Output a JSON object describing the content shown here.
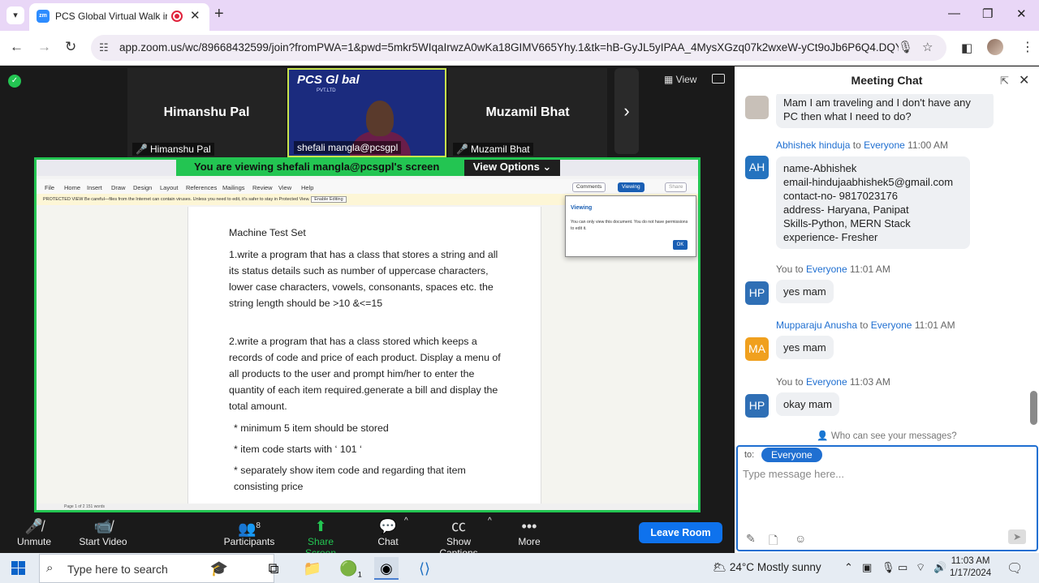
{
  "browser": {
    "tab_title": "PCS Global Virtual Walk in-",
    "tab_favicon": "zm",
    "url": "app.zoom.us/wc/89668432599/join?fromPWA=1&pwd=5mkr5WIqaIrwzA0wKa18GIMV665Yhy.1&tk=hB-GyJL5yIPAA_4MysXGzq07k2wxeW-yCt9oJb6P6Q4.DQYAAA..."
  },
  "meeting": {
    "view_label": "View",
    "participants": [
      {
        "name": "Himanshu Pal",
        "label": "Himanshu Pal"
      },
      {
        "label": "shefali mangla@pcsgpl",
        "logo": "PCS Gl bal",
        "logo_sub": "PVT.LTD"
      },
      {
        "name": "Muzamil Bhat",
        "label": "Muzamil Bhat"
      }
    ],
    "share_banner": "You are viewing  shefali mangla@pcsgpl's screen",
    "view_options": "View Options"
  },
  "document": {
    "menu": [
      "File",
      "Home",
      "Insert",
      "Draw",
      "Design",
      "Layout",
      "References",
      "Mailings",
      "Review",
      "View",
      "Help"
    ],
    "comments_btn": "Comments",
    "viewing_btn": "Viewing",
    "share_btn": "Share",
    "protected_bar": "PROTECTED VIEW  Be careful—files from the Internet can contain viruses. Unless you need to edit, it's safer to stay in Protected View.",
    "enable_editing": "Enable Editing",
    "popup_title": "Viewing",
    "popup_msg": "You can only view this document. You do not have permissions to edit it.",
    "popup_ok": "OK",
    "status": "Page 1 of 2     151 words",
    "title": "Machine Test Set",
    "q1": "1.write a program that has a class that stores a string and all its status details such as number of uppercase characters, lower case characters, vowels, consonants, spaces etc. the string length should be >10 &<=15",
    "q2": "2.write a program that has a class stored which keeps a records of code and price of  each product. Display a menu of all products to the user and prompt him/her to enter the quantity of each item required.generate a bill and display the total amount.",
    "b1": "* minimum 5 item should be stored",
    "b2": "* item code starts with ‘ 101 ‘",
    "b3": "* separately show item code and regarding that item consisting price"
  },
  "toolbar": {
    "unmute": "Unmute",
    "start_video": "Start Video",
    "participants": "Participants",
    "participants_count": "8",
    "share_screen": "Share Screen",
    "chat": "Chat",
    "captions": "Show Captions",
    "more": "More",
    "leave": "Leave Room"
  },
  "chat": {
    "title": "Meeting Chat",
    "partial_msg": "Mam I am traveling and I don't have any PC then what I need to do?",
    "messages": [
      {
        "from": "Abhishek hinduja",
        "to": "Everyone",
        "time": "11:00 AM",
        "initials": "AH",
        "color": "#2573bf",
        "lines": [
          "name-Abhishek",
          "email-hindujaabhishek5@gmail.com",
          "contact-no- 9817023176",
          "address- Haryana, Panipat",
          "Skills-Python, MERN Stack",
          "experience- Fresher"
        ]
      },
      {
        "from": "You",
        "to": "Everyone",
        "time": "11:01 AM",
        "initials": "HP",
        "color": "#2f6fb5",
        "text": "yes mam"
      },
      {
        "from": "Mupparaju Anusha",
        "to": "Everyone",
        "time": "11:01 AM",
        "initials": "MA",
        "color": "#f0a01e",
        "text": "yes mam"
      },
      {
        "from": "You",
        "to": "Everyone",
        "time": "11:03 AM",
        "initials": "HP",
        "color": "#2f6fb5",
        "text": "okay mam"
      }
    ],
    "to_word": "to",
    "who_can_see": "Who can see your messages?",
    "to_label": "to:",
    "recipient": "Everyone",
    "placeholder": "Type message here..."
  },
  "taskbar": {
    "search": "Type here to search",
    "whatsapp_badge": "1",
    "temperature": "24°C",
    "weather": "Mostly sunny",
    "time": "11:03 AM",
    "date": "1/17/2024"
  }
}
